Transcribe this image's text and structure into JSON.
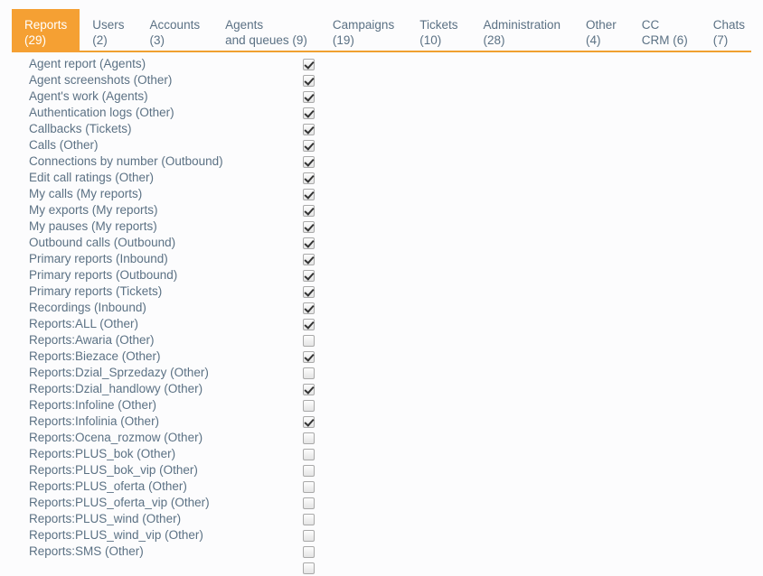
{
  "tabs": [
    {
      "line1": "Reports",
      "line2": "(29)",
      "active": true
    },
    {
      "line1": "Users",
      "line2": "(2)",
      "active": false
    },
    {
      "line1": "Accounts",
      "line2": "(3)",
      "active": false
    },
    {
      "line1": "Agents",
      "line2": "and queues (9)",
      "active": false
    },
    {
      "line1": "Campaigns",
      "line2": "(19)",
      "active": false
    },
    {
      "line1": "Tickets",
      "line2": "(10)",
      "active": false
    },
    {
      "line1": "Administration",
      "line2": "(28)",
      "active": false
    },
    {
      "line1": "Other",
      "line2": "(4)",
      "active": false
    },
    {
      "line1": "CC",
      "line2": "CRM (6)",
      "active": false
    },
    {
      "line1": "Chats",
      "line2": "(7)",
      "active": false
    }
  ],
  "permissions": [
    {
      "label": "Agent report (Agents)",
      "checked": true
    },
    {
      "label": "Agent screenshots (Other)",
      "checked": true
    },
    {
      "label": "Agent's work (Agents)",
      "checked": true
    },
    {
      "label": "Authentication logs (Other)",
      "checked": true
    },
    {
      "label": "Callbacks (Tickets)",
      "checked": true
    },
    {
      "label": "Calls (Other)",
      "checked": true
    },
    {
      "label": "Connections by number (Outbound)",
      "checked": true
    },
    {
      "label": "Edit call ratings (Other)",
      "checked": true
    },
    {
      "label": "My calls (My reports)",
      "checked": true
    },
    {
      "label": "My exports (My reports)",
      "checked": true
    },
    {
      "label": "My pauses (My reports)",
      "checked": true
    },
    {
      "label": "Outbound calls (Outbound)",
      "checked": true
    },
    {
      "label": "Primary reports (Inbound)",
      "checked": true
    },
    {
      "label": "Primary reports (Outbound)",
      "checked": true
    },
    {
      "label": "Primary reports (Tickets)",
      "checked": true
    },
    {
      "label": "Recordings (Inbound)",
      "checked": true
    },
    {
      "label": "Reports:ALL (Other)",
      "checked": true
    },
    {
      "label": "Reports:Awaria (Other)",
      "checked": false
    },
    {
      "label": "Reports:Biezace (Other)",
      "checked": true
    },
    {
      "label": "Reports:Dzial_Sprzedazy (Other)",
      "checked": false
    },
    {
      "label": "Reports:Dzial_handlowy (Other)",
      "checked": true
    },
    {
      "label": "Reports:Infoline (Other)",
      "checked": false
    },
    {
      "label": "Reports:Infolinia (Other)",
      "checked": true
    },
    {
      "label": "Reports:Ocena_rozmow (Other)",
      "checked": false
    },
    {
      "label": "Reports:PLUS_bok (Other)",
      "checked": false
    },
    {
      "label": "Reports:PLUS_bok_vip (Other)",
      "checked": false
    },
    {
      "label": "Reports:PLUS_oferta (Other)",
      "checked": false
    },
    {
      "label": "Reports:PLUS_oferta_vip (Other)",
      "checked": false
    },
    {
      "label": "Reports:PLUS_wind (Other)",
      "checked": false
    },
    {
      "label": "Reports:PLUS_wind_vip (Other)",
      "checked": false
    },
    {
      "label": "Reports:SMS (Other)",
      "checked": false
    },
    {
      "label": "",
      "checked": false
    }
  ],
  "colors": {
    "accent": "#f5a033",
    "text": "#5b7184",
    "background": "#fcfcfd"
  }
}
